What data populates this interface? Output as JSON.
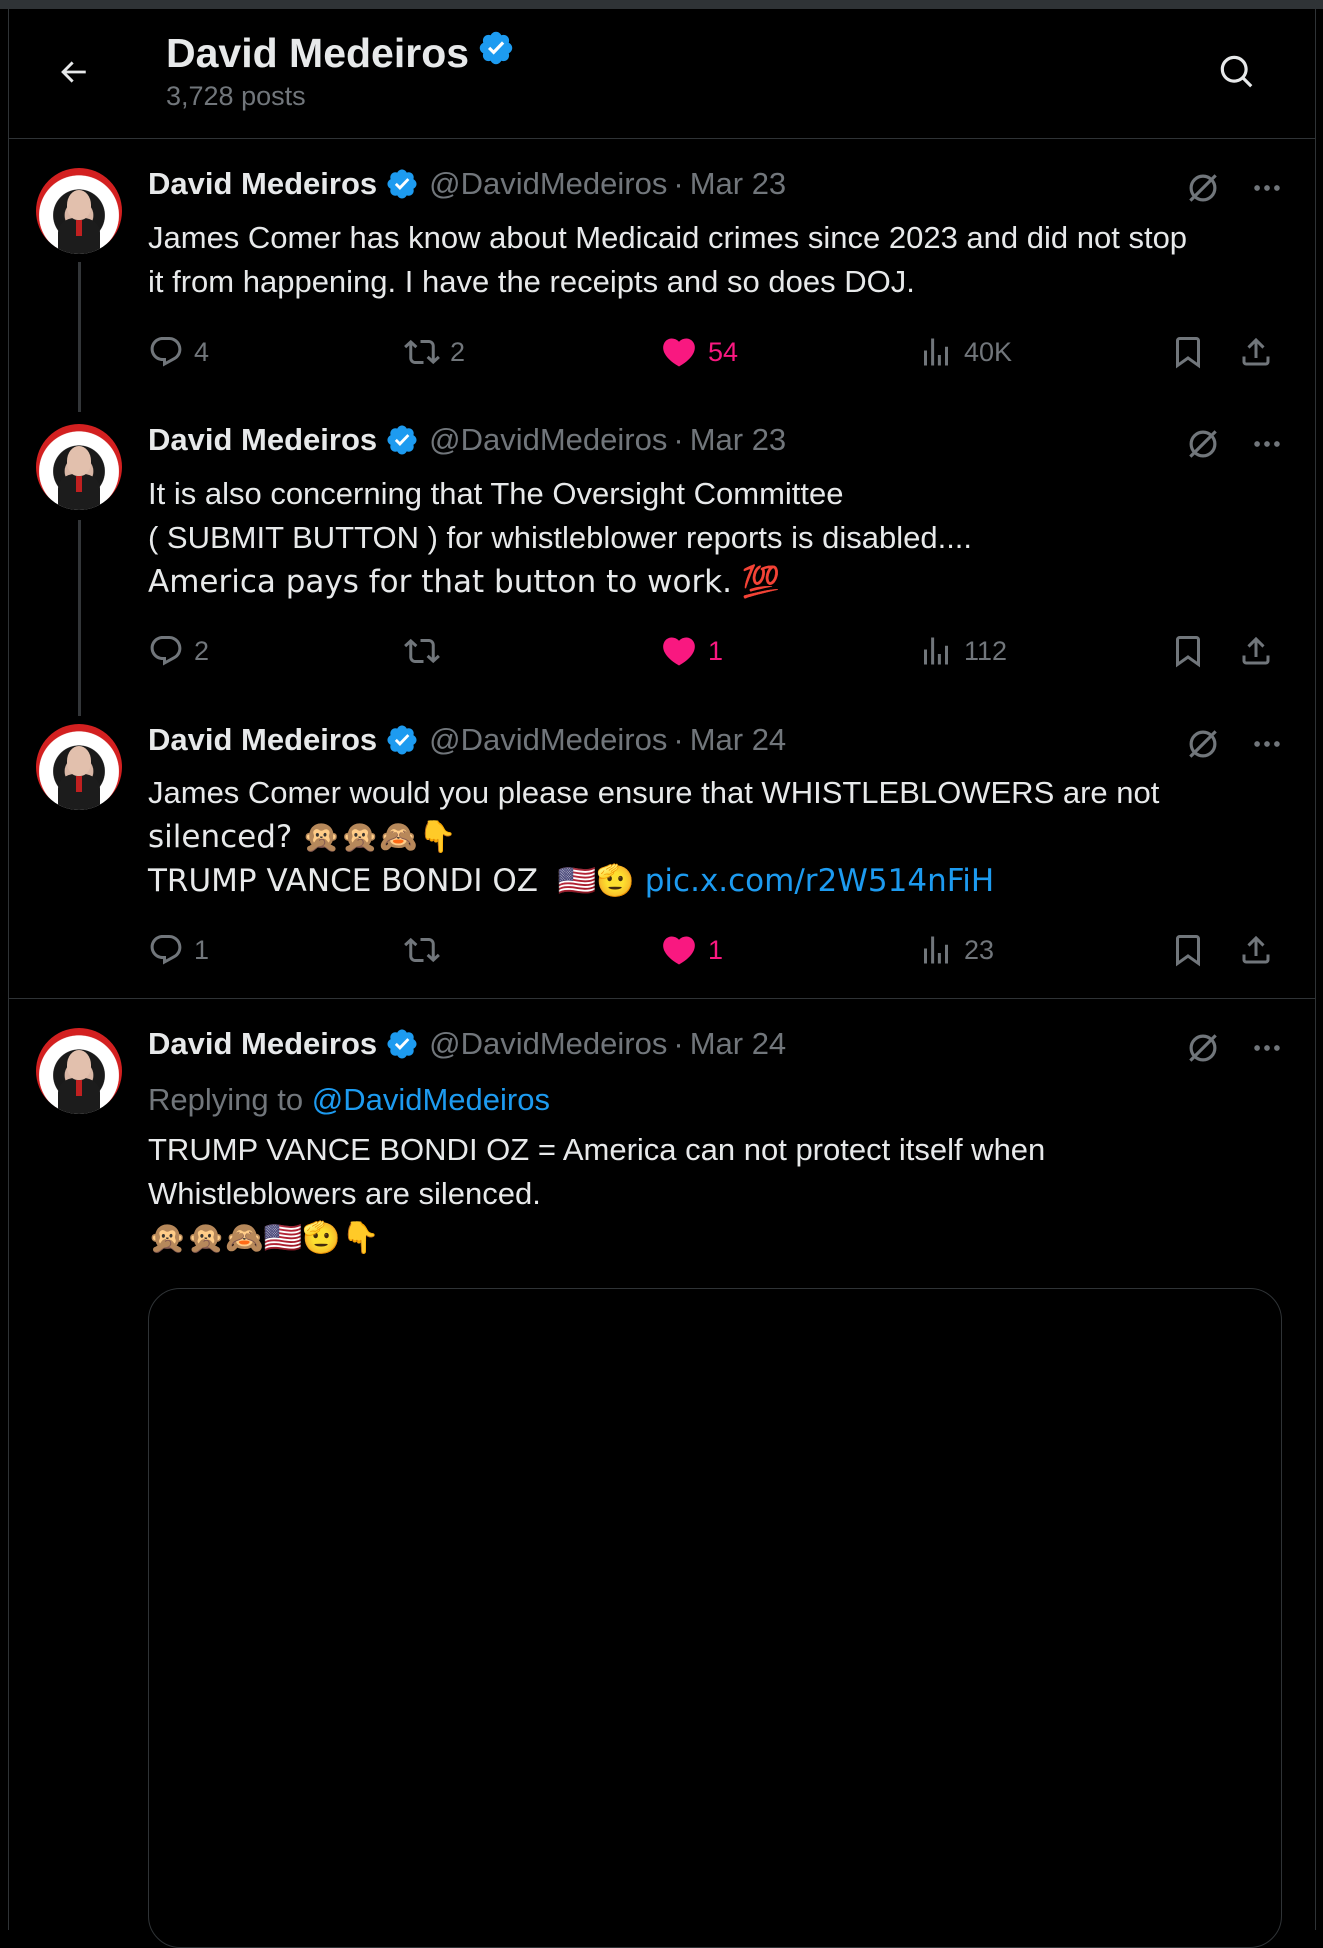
{
  "header": {
    "name": "David Medeiros",
    "post_count": "3,728 posts"
  },
  "colors": {
    "background": "#000000",
    "text": "#e7e9ea",
    "muted": "#71767b",
    "link": "#1d9bf0",
    "like": "#f91880",
    "verified": "#1d9bf0"
  },
  "posts": [
    {
      "name": "David Medeiros",
      "handle": "@DavidMedeiros",
      "date": "Mar 23",
      "lines": [
        "James Comer has know about Medicaid crimes since 2023 and did not stop",
        "it from happening. I have the receipts and so does DOJ."
      ],
      "replies": "4",
      "reposts": "2",
      "likes": "54",
      "views": "40K"
    },
    {
      "name": "David Medeiros",
      "handle": "@DavidMedeiros",
      "date": "Mar 23",
      "lines": [
        "It is also concerning that The Oversight Committee",
        "( SUBMIT BUTTON ) for whistleblower reports is disabled....",
        "America pays for that button to work. 💯"
      ],
      "replies": "2",
      "reposts": "",
      "likes": "1",
      "views": "112"
    },
    {
      "name": "David Medeiros",
      "handle": "@DavidMedeiros",
      "date": "Mar 24",
      "lines": [
        "James Comer would you please ensure that WHISTLEBLOWERS are not",
        "silenced? 🙊🙊🙈👇",
        "TRUMP VANCE BONDI OZ  🇺🇸🫡 "
      ],
      "link": "pic.x.com/r2W514nFiH",
      "replies": "1",
      "reposts": "",
      "likes": "1",
      "views": "23"
    },
    {
      "name": "David Medeiros",
      "handle": "@DavidMedeiros",
      "date": "Mar 24",
      "replying_label": "Replying to ",
      "replying_handle": "@DavidMedeiros",
      "lines": [
        "TRUMP VANCE BONDI OZ = America can not protect itself when",
        "Whistleblowers are silenced.",
        "🙊🙊🙈🇺🇸🫡👇"
      ]
    }
  ]
}
